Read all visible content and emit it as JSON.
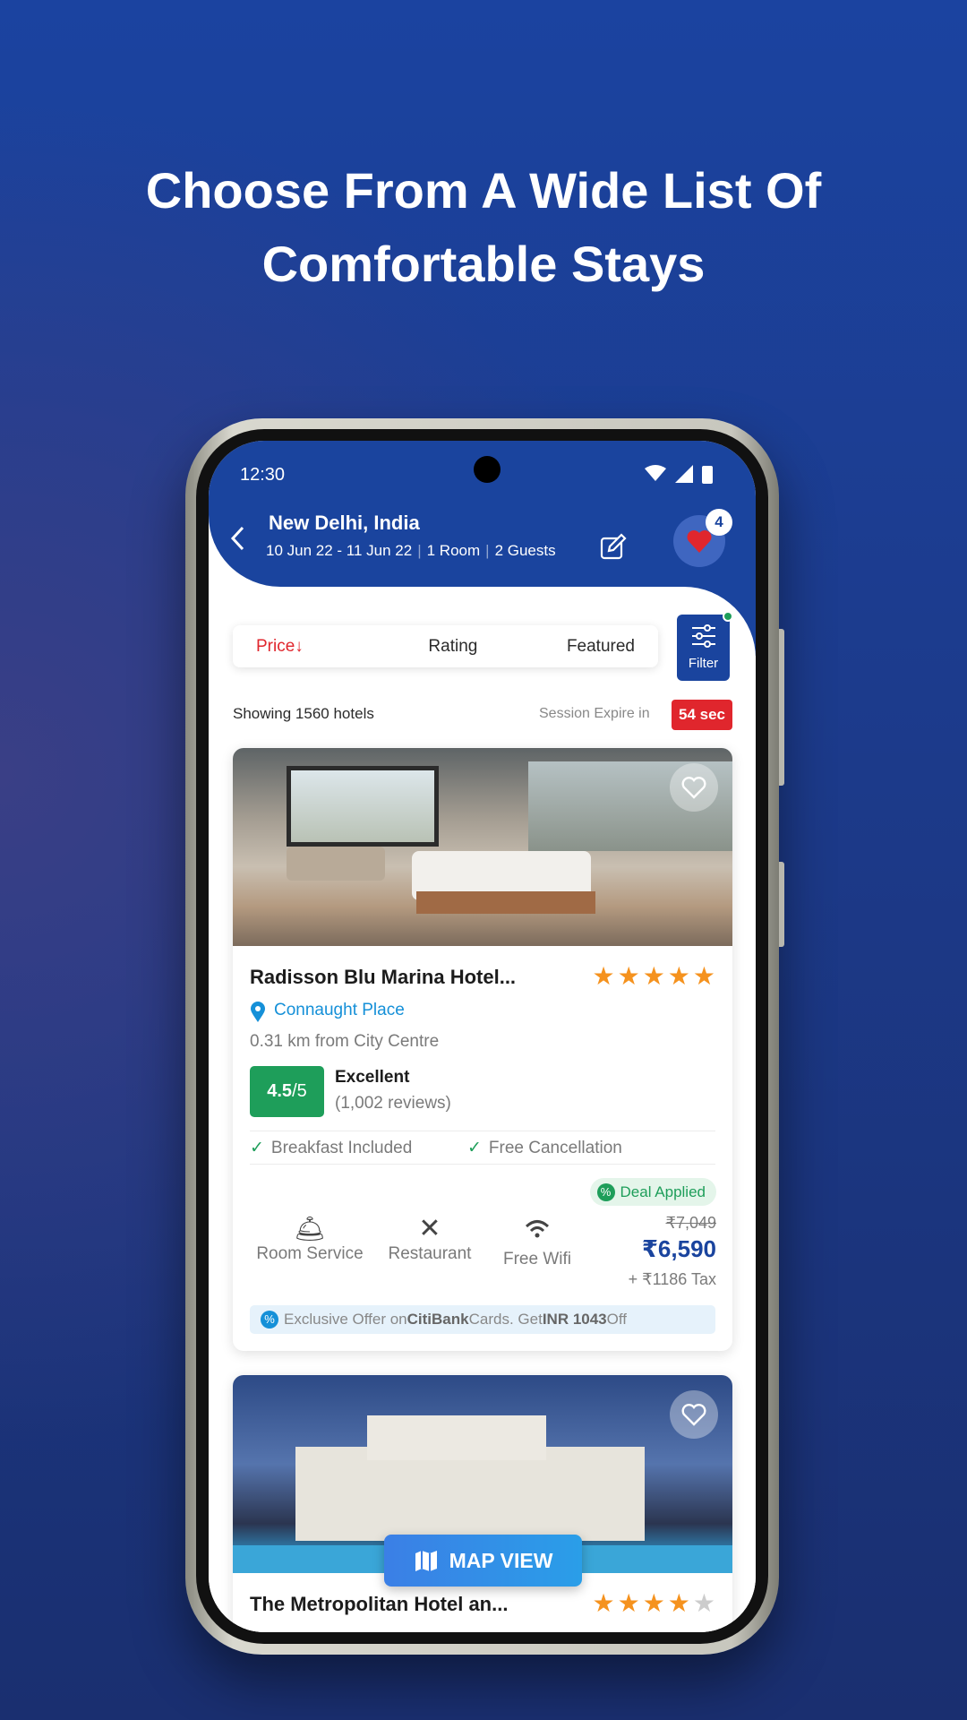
{
  "hero": {
    "line1": "Choose From A Wide List Of",
    "line2": "Comfortable Stays"
  },
  "status_bar": {
    "time": "12:30"
  },
  "header": {
    "city": "New Delhi, India",
    "dates": "10 Jun 22 - 11 Jun 22",
    "rooms": "1 Room",
    "guests": "2 Guests",
    "wishlist_count": "4"
  },
  "sort": {
    "price": "Price",
    "price_arrow": "↓",
    "rating": "Rating",
    "featured": "Featured",
    "filter": "Filter"
  },
  "summary": {
    "showing": "Showing 1560 hotels",
    "session_label": "Session Expire in",
    "session_value": "54 sec"
  },
  "colors": {
    "primary": "#1a449e",
    "accent_red": "#e0262d",
    "rating_green": "#1e9e5a",
    "star": "#f5921e",
    "link_blue": "#1590d8"
  },
  "hotels": [
    {
      "name": "Radisson Blu Marina Hotel...",
      "stars": 5,
      "location": "Connaught Place",
      "distance": "0.31 km from City Centre",
      "rating": "4.5",
      "rating_max": "/5",
      "rating_label": "Excellent",
      "reviews": "(1,002 reviews)",
      "features": [
        "Breakfast Included",
        "Free Cancellation"
      ],
      "deal": "Deal Applied",
      "amenities": [
        "Room Service",
        "Restaurant",
        "Free Wifi"
      ],
      "old_price": "₹7,049",
      "price": "₹6,590",
      "tax": "+ ₹1186 Tax",
      "offer": {
        "pre": "Exclusive Offer on ",
        "bank": "CitiBank",
        "mid": " Cards. Get ",
        "amount": "INR 1043",
        "post": " Off"
      }
    },
    {
      "name": "The Metropolitan Hotel an...",
      "stars": 4
    }
  ],
  "map_view": "MAP VIEW"
}
